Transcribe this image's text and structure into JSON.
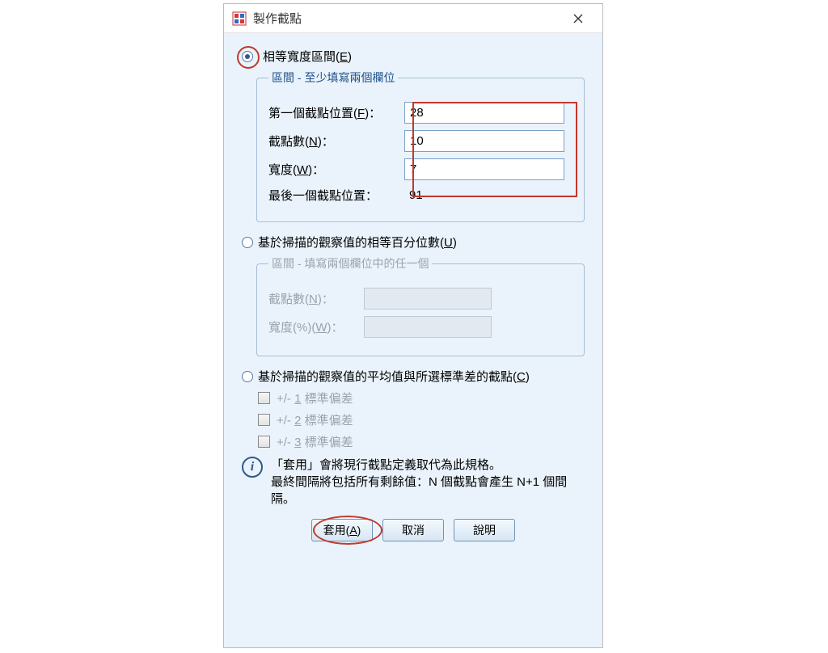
{
  "dialog": {
    "title": "製作截點",
    "close_label": "✕"
  },
  "option1": {
    "label_pre": "相等寬度區間(",
    "mn": "E",
    "label_post": ")",
    "selected": true,
    "groupbox_legend": "區間 - 至少填寫兩個欄位",
    "first_cut": {
      "label_pre": "第一個截點位置(",
      "mn": "F",
      "label_post": ")：",
      "value": "28"
    },
    "ncuts": {
      "label_pre": "截點數(",
      "mn": "N",
      "label_post": ")：",
      "value": "10"
    },
    "width": {
      "label_pre": "寬度(",
      "mn": "W",
      "label_post": ")：",
      "value": "7"
    },
    "last_cut": {
      "label": "最後一個截點位置：",
      "value": "91"
    }
  },
  "option2": {
    "label_pre": "基於掃描的觀察值的相等百分位數(",
    "mn": "U",
    "label_post": ")",
    "selected": false,
    "groupbox_legend": "區間 - 填寫兩個欄位中的任一個",
    "ncuts": {
      "label_pre": "截點數(",
      "mn": "N",
      "label_post": ")：",
      "value": ""
    },
    "width": {
      "label_pre": "寬度(%)(",
      "mn": "W",
      "label_post": ")：",
      "value": ""
    }
  },
  "option3": {
    "label_pre": "基於掃描的觀察值的平均值與所選標準差的截點(",
    "mn": "C",
    "label_post": ")",
    "selected": false,
    "chk1": {
      "pre": "+/- ",
      "mn": "1",
      "post": " 標準偏差"
    },
    "chk2": {
      "pre": "+/- ",
      "mn": "2",
      "post": " 標準偏差"
    },
    "chk3": {
      "pre": "+/- ",
      "mn": "3",
      "post": " 標準偏差"
    }
  },
  "info": {
    "line1": "「套用」會將現行截點定義取代為此規格。",
    "line2": "最終間隔將包括所有剩餘值：N 個截點會產生 N+1 個間隔。"
  },
  "buttons": {
    "apply": {
      "pre": "套用(",
      "mn": "A",
      "post": ")"
    },
    "cancel": "取消",
    "help": "說明"
  }
}
